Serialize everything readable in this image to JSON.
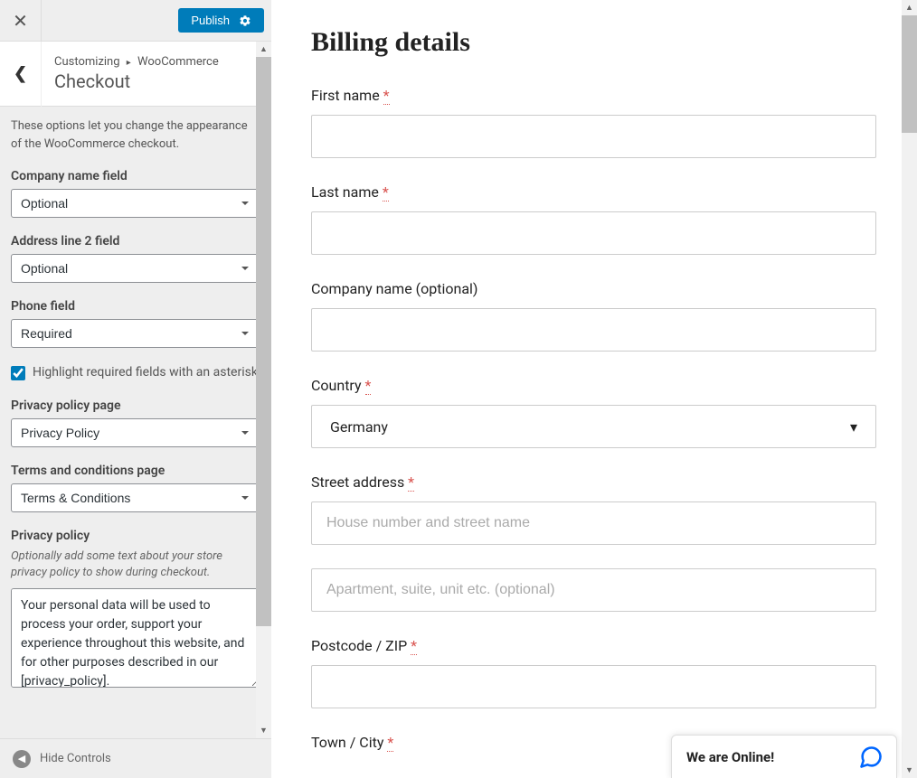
{
  "header": {
    "publish_label": "Publish"
  },
  "breadcrumb": {
    "root": "Customizing",
    "section": "WooCommerce",
    "title": "Checkout"
  },
  "sidebar": {
    "desc": "These options let you change the appearance of the WooCommerce checkout.",
    "company_label": "Company name field",
    "company_value": "Optional",
    "address2_label": "Address line 2 field",
    "address2_value": "Optional",
    "phone_label": "Phone field",
    "phone_value": "Required",
    "highlight_label": "Highlight required fields with an asterisk",
    "highlight_checked": true,
    "privacy_page_label": "Privacy policy page",
    "privacy_page_value": "Privacy Policy",
    "terms_page_label": "Terms and conditions page",
    "terms_page_value": "Terms & Conditions",
    "privacy_policy_label": "Privacy policy",
    "privacy_policy_help": "Optionally add some text about your store privacy policy to show during checkout.",
    "privacy_policy_text": "Your personal data will be used to process your order, support your experience throughout this website, and for other purposes described in our [privacy_policy].",
    "hide_controls": "Hide Controls"
  },
  "preview": {
    "title": "Billing details",
    "first_name_label": "First name",
    "last_name_label": "Last name",
    "company_label": "Company name (optional)",
    "country_label": "Country",
    "country_value": "Germany",
    "street_label": "Street address",
    "street_placeholder": "House number and street name",
    "street2_placeholder": "Apartment, suite, unit etc. (optional)",
    "postcode_label": "Postcode / ZIP",
    "town_label": "Town / City",
    "required_mark": "*"
  },
  "chat": {
    "text": "We are Online!"
  }
}
